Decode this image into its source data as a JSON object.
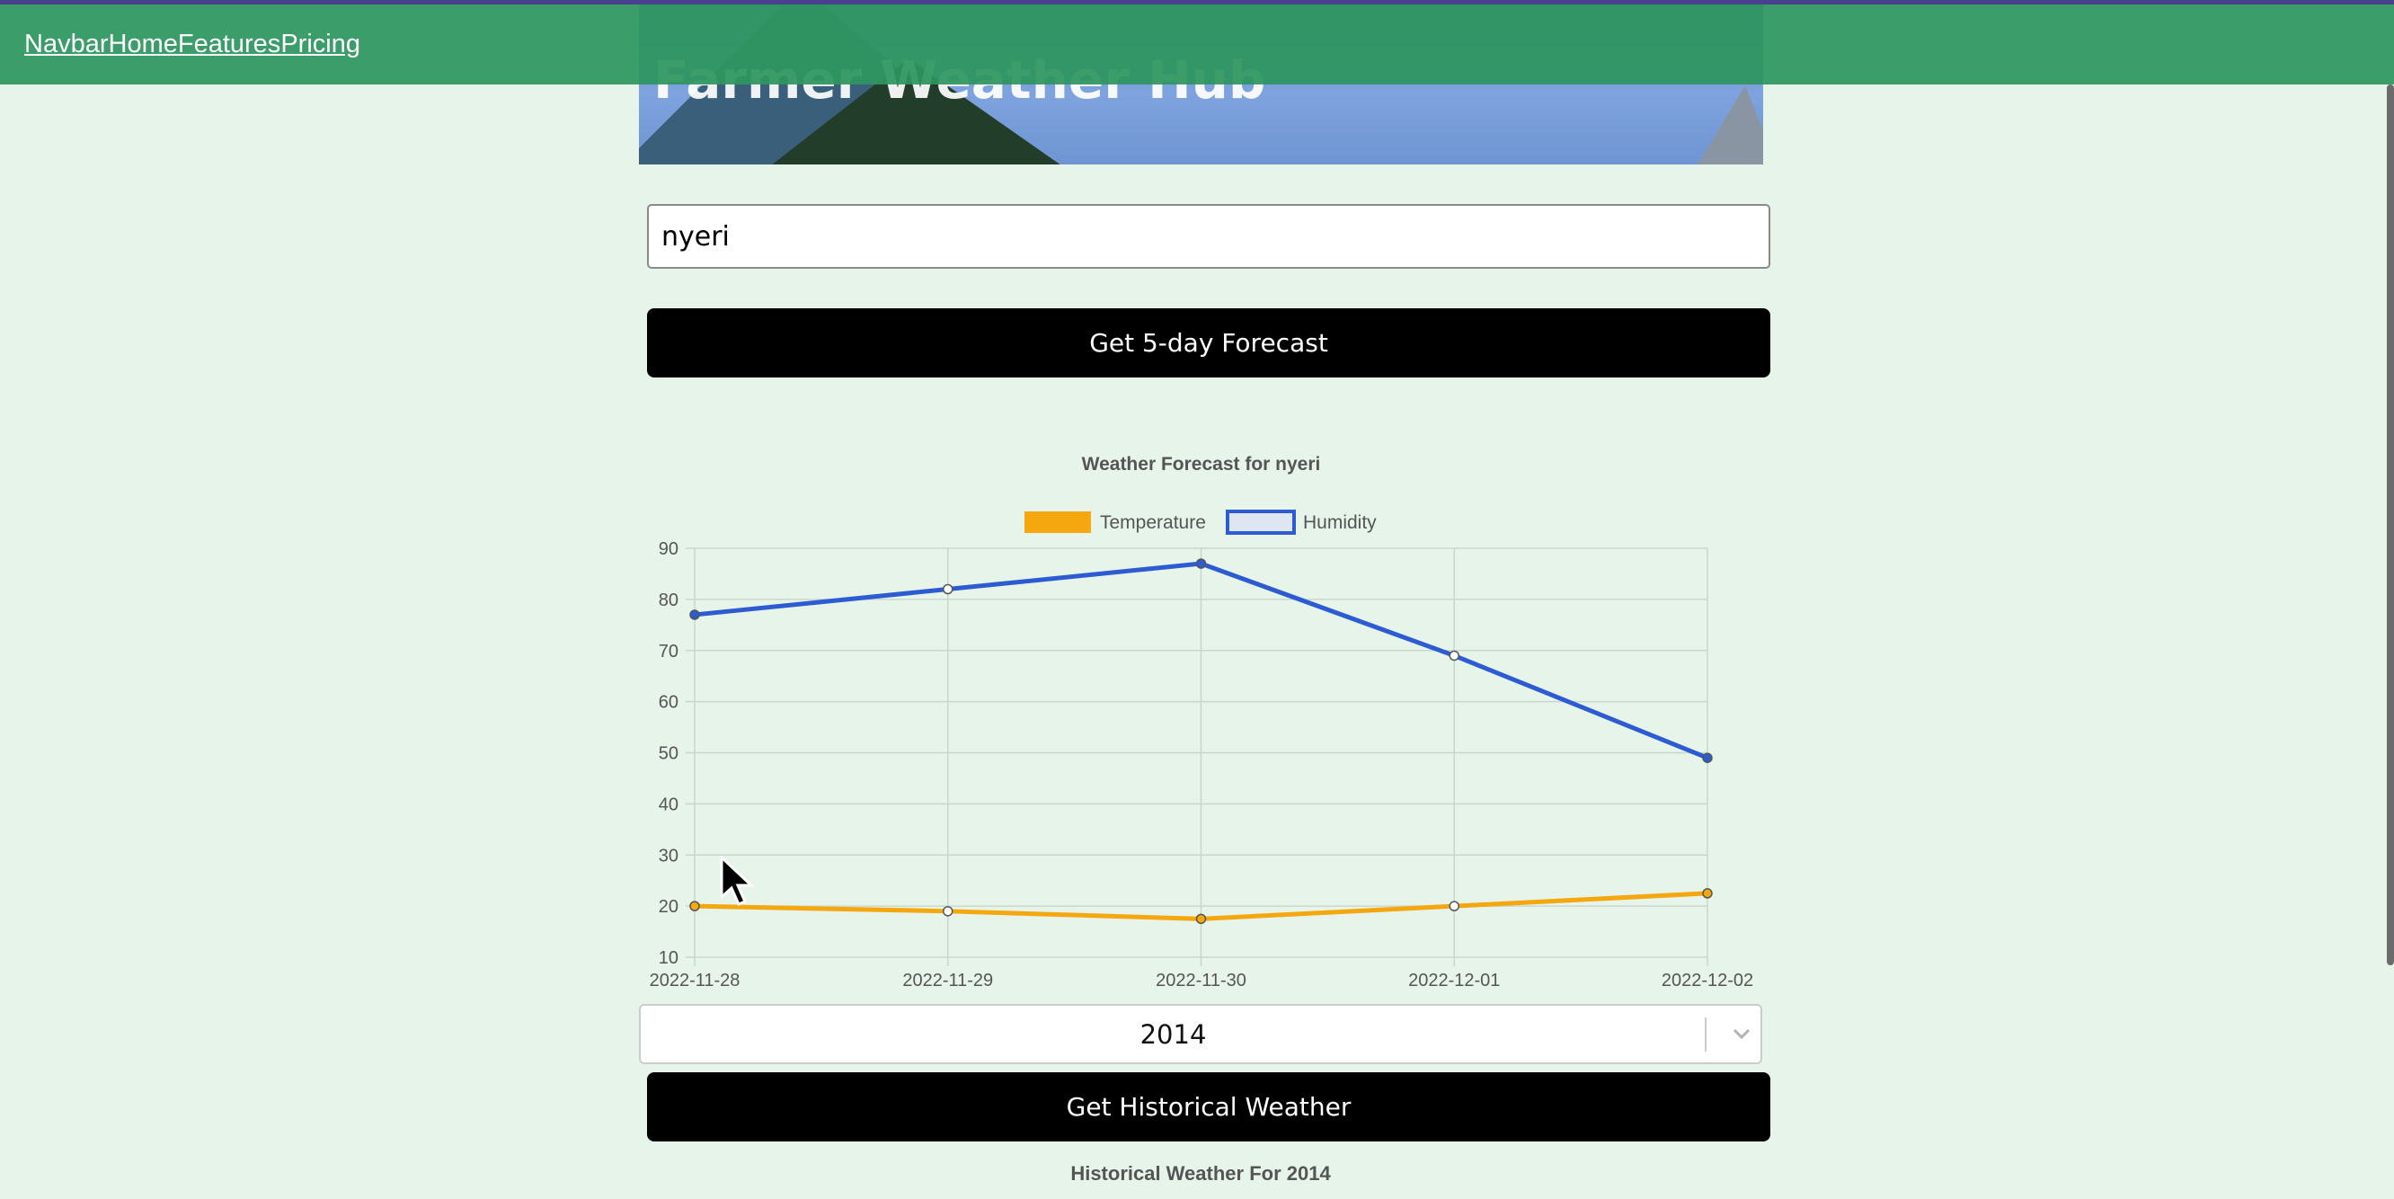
{
  "navbar": {
    "links": [
      "Navbar",
      "Home",
      "Features",
      "Pricing"
    ]
  },
  "hero": {
    "title": "Farmer Weather Hub"
  },
  "search": {
    "value": "nyeri"
  },
  "forecast_button": {
    "label": "Get 5-day Forecast"
  },
  "year_select": {
    "value": "2014"
  },
  "historical_button": {
    "label": "Get Historical Weather"
  },
  "historical_heading": "Historical Weather For 2014",
  "colors": {
    "background": "#e6f4ea",
    "navbar": "#2d965f",
    "temperature": "#f5a70f",
    "humidity": "#2d5bd1",
    "button": "#000000"
  },
  "chart_data": {
    "type": "line",
    "title": "Weather Forecast for nyeri",
    "categories": [
      "2022-11-28",
      "2022-11-29",
      "2022-11-30",
      "2022-12-01",
      "2022-12-02"
    ],
    "series": [
      {
        "name": "Temperature",
        "values": [
          20,
          19,
          17.5,
          20,
          22.5
        ]
      },
      {
        "name": "Humidity",
        "values": [
          77,
          82,
          87,
          69,
          49
        ]
      }
    ],
    "ylim": [
      10,
      90
    ],
    "yticks": [
      10,
      20,
      30,
      40,
      50,
      60,
      70,
      80,
      90
    ],
    "grid": true,
    "legend": "top-center"
  }
}
